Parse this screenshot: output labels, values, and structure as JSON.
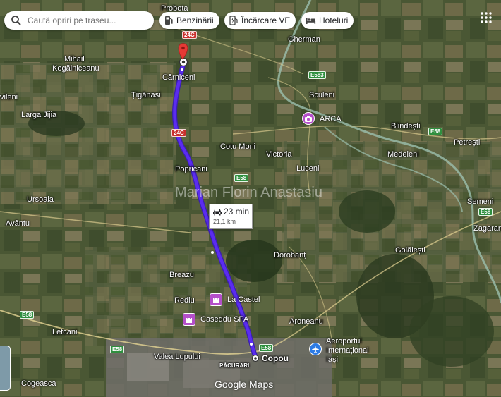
{
  "search": {
    "placeholder": "Caută opriri pe traseu..."
  },
  "chips": {
    "fuel": "Benzinării",
    "ev": "Încărcare VE",
    "hotels": "Hoteluri"
  },
  "route": {
    "duration": "23 min",
    "distance": "21,1 km"
  },
  "watermark": "Marian Florin Anastasiu",
  "branding": "Google Maps",
  "places": {
    "probota": "Probota",
    "gherman": "Gherman",
    "mihail": "Mihail",
    "kogalniceanu": "Kogălniceanu",
    "carniceni": "Cârniceni",
    "tiganasi": "Țigănași",
    "vileni": "vileni",
    "larga_jijia": "Larga Jijia",
    "sculeni": "Sculeni",
    "arca": "ARCA",
    "blindesti": "Blindești",
    "petresti": "Petrești",
    "medeleni": "Medeleni",
    "cotu_morii": "Cotu Morii",
    "victoria": "Victoria",
    "luceni": "Luceni",
    "popricani": "Popricani",
    "ursoaia": "Ursoaia",
    "semeni": "Semeni",
    "avantu": "Avântu",
    "zagarancea": "Zagaranc",
    "golaiesti": "Golăiești",
    "dorobant": "Dorobanț",
    "breazu": "Breazu",
    "rediu": "Rediu",
    "la_castel": "La Castel",
    "caseddu": "Caseddu SPA",
    "aroneanu": "Aroneanu",
    "leteani": "Letcani",
    "aeroport_1": "Aeroportul",
    "aeroport_2": "Internațional",
    "aeroport_3": "Iași",
    "valea_lupului": "Valea Lupului",
    "copou": "Copou",
    "pacurari": "PĂCURARI",
    "cogeasca": "Cogeasca"
  },
  "shields": {
    "r24c_top": "24C",
    "r24c_mid": "24C",
    "e583": "E583",
    "e58_right": "E58",
    "e58_semeni": "E58",
    "e58_center": "E58",
    "e58_left": "E58",
    "e58_bottom": "E58",
    "e58_copou": "E58"
  },
  "colors": {
    "route": "#5b2cf0",
    "marker": "#e53935",
    "poi": "#b44fc9",
    "road_shield": "#2f8f3f"
  }
}
